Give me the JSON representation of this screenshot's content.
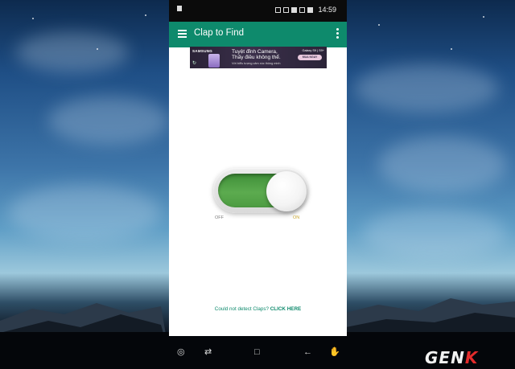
{
  "status_bar": {
    "time": "14:59",
    "icons": [
      "sim-icon",
      "mute-icon",
      "wifi-icon",
      "data-icon",
      "signal-icon",
      "battery-icon"
    ]
  },
  "app_bar": {
    "title": "Clap to Find",
    "menu_icon": "hamburger-menu-icon",
    "overflow_icon": "more-vert-icon",
    "color": "#0e8a6c"
  },
  "ad_banner": {
    "brand": "SAMSUNG",
    "line1": "Tuyệt đỉnh Camera,",
    "line2": "Thấy điều không thể.",
    "line3": "Với biểu tượng cảm xúc thông minh",
    "model": "Galaxy S9 | S9+",
    "cta": "MUA NGAY"
  },
  "toggle": {
    "state": "on",
    "off_label": "OFF",
    "on_label": "ON",
    "track_color": "#5cab4f"
  },
  "help": {
    "prompt": "Could not detect Claps?",
    "cta": "CLICK HERE"
  },
  "nav_bar": {
    "buttons": [
      "screenshot-icon",
      "recent-apps-icon",
      "home-icon",
      "back-icon",
      "assistant-icon"
    ]
  },
  "watermark": {
    "main": "GEN",
    "accent": "K"
  }
}
